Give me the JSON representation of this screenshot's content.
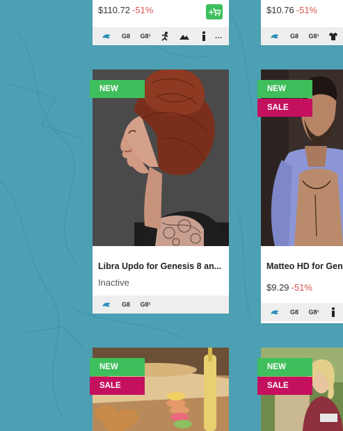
{
  "cards": {
    "top_left": {
      "price": "$110.72",
      "discount": "-51%",
      "cart_icon": "add-to-cart-icon",
      "compat": [
        "G8",
        "G8¹"
      ]
    },
    "top_right": {
      "price": "$10.76",
      "discount": "-51%",
      "compat": [
        "G8",
        "G8¹"
      ]
    },
    "mid_left": {
      "badge": "NEW",
      "title": "Libra Updo for Genesis 8 an...",
      "status": "Inactive",
      "compat": [
        "G8",
        "G8¹"
      ]
    },
    "mid_right": {
      "badge_new": "NEW",
      "badge_sale": "SALE",
      "title": "Matteo HD for Gen",
      "price": "$9.29",
      "discount": "-51%",
      "compat": [
        "G8",
        "G8¹"
      ]
    },
    "bottom_left": {
      "badge_new": "NEW",
      "badge_sale": "SALE"
    },
    "bottom_right": {
      "badge_new": "NEW",
      "badge_sale": "SALE"
    }
  },
  "colors": {
    "new": "#3fbf5c",
    "sale": "#c4105f",
    "discount": "#d9534f",
    "background": "#4da0b3"
  }
}
